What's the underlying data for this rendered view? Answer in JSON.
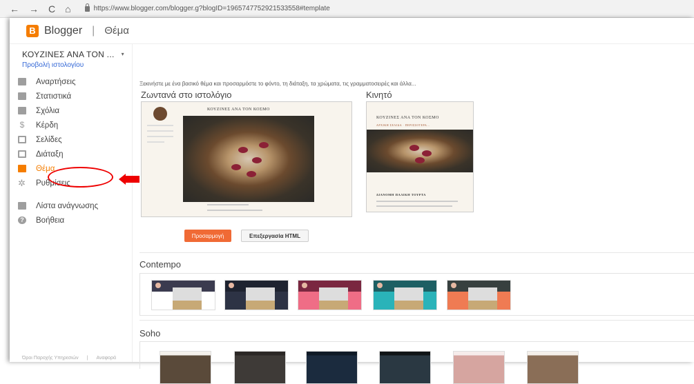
{
  "browser": {
    "back": "←",
    "forward": "→",
    "reload": "C",
    "home": "⌂",
    "url": "https://www.blogger.com/blogger.g?blogID=1965747752921533558#template"
  },
  "header": {
    "brand": "Blogger",
    "logo_letter": "B",
    "separator": "|",
    "section": "Θέμα"
  },
  "sidebar": {
    "blog_name": "ΚΟΥΖΙΝΕΣ ΑΝΑ ΤΟΝ ...",
    "caret": "▾",
    "view_blog": "Προβολή ιστολογίου",
    "items": [
      {
        "label": "Αναρτήσεις",
        "icon": "posts-icon"
      },
      {
        "label": "Στατιστικά",
        "icon": "stats-icon"
      },
      {
        "label": "Σχόλια",
        "icon": "comments-icon"
      },
      {
        "label": "Κέρδη",
        "icon": "earnings-icon"
      },
      {
        "label": "Σελίδες",
        "icon": "pages-icon"
      },
      {
        "label": "Διάταξη",
        "icon": "layout-icon"
      },
      {
        "label": "Θέμα",
        "icon": "theme-icon"
      },
      {
        "label": "Ρυθμίσεις",
        "icon": "settings-icon"
      },
      {
        "label": "Λίστα ανάγνωσης",
        "icon": "reading-list-icon"
      },
      {
        "label": "Βοήθεια",
        "icon": "help-icon"
      }
    ],
    "footer_terms": "Όροι Παροχής Υπηρεσιών",
    "footer_divider": "|",
    "footer_report": "Αναφορά",
    "active_color": "#f57d00"
  },
  "main": {
    "intro": "Ξεκινήστε με ένα βασικό θέμα και προσαρμόστε το φόντο, τη διάταξη, τα χρώματα, τις γραμματοσειρές και άλλα...",
    "live_heading": "Ζωντανά στο ιστολόγιο",
    "mobile_heading": "Κινητό",
    "preview_blog_title": "ΚΟΥΖΙΝΕΣ ΑΝΑ ΤΟΝ ΚΟΣΜΟ",
    "mobile_subnav": "ΑΡΧΙΚΗ ΣΕΛΙΔΑ · ΠΕΡΙΣΣΟΤΕΡΑ...",
    "mobile_post_title": "ΔΙΑΝΟΜΗ ΠΑΛΙΚΗ ΤΟΥΡΤΑ",
    "customize_button": "Προσαρμογή",
    "edit_html_button": "Επεξεργασία HTML",
    "accent": "#f06a35",
    "theme_groups": [
      {
        "name": "Contempo",
        "variants": [
          {
            "header": "#3b3b4f",
            "body": "#ffffff"
          },
          {
            "header": "#1e2330",
            "body": "#2d3345"
          },
          {
            "header": "#7a2740",
            "body": "#ef6d86"
          },
          {
            "header": "#1d5f63",
            "body": "#2ab3b9"
          },
          {
            "header": "#37403f",
            "body": "#ef7b53"
          }
        ]
      },
      {
        "name": "Soho",
        "variants": [
          {
            "tone": "#5a4a3a"
          },
          {
            "tone": "#3e3a37"
          },
          {
            "tone": "#1b2b3e"
          },
          {
            "tone": "#2a3842"
          },
          {
            "tone": "#d6a5a0"
          },
          {
            "tone": "#8a6e57"
          }
        ]
      }
    ]
  },
  "annotation_color": "#e00000"
}
